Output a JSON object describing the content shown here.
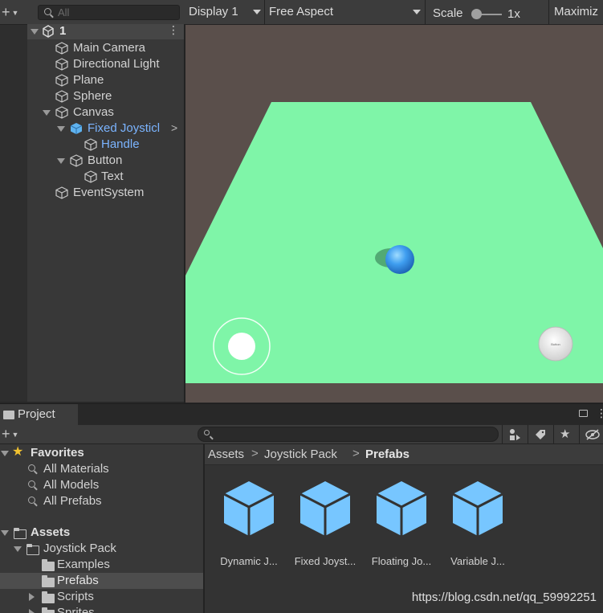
{
  "hierarchy": {
    "search_placeholder": "All",
    "scene_name": "1",
    "items": [
      {
        "label": "Main Camera"
      },
      {
        "label": "Directional Light"
      },
      {
        "label": "Plane"
      },
      {
        "label": "Sphere"
      },
      {
        "label": "Canvas"
      },
      {
        "label": "Fixed Joysticl"
      },
      {
        "label": "Handle"
      },
      {
        "label": "Button"
      },
      {
        "label": "Text"
      },
      {
        "label": "EventSystem"
      }
    ]
  },
  "game_toolbar": {
    "display": "Display 1",
    "aspect": "Free Aspect",
    "scale_label": "Scale",
    "scale_value": "1x",
    "maximize": "Maximiz"
  },
  "game_view": {
    "button_text": "Button"
  },
  "project": {
    "tab_label": "Project",
    "tree": {
      "favorites": "Favorites",
      "fav_items": [
        "All Materials",
        "All Models",
        "All Prefabs"
      ],
      "assets": "Assets",
      "joystick_pack": "Joystick Pack",
      "examples": "Examples",
      "prefabs": "Prefabs",
      "scripts": "Scripts",
      "sprites": "Sprites"
    },
    "breadcrumb": [
      "Assets",
      "Joystick Pack",
      "Prefabs"
    ],
    "assets_grid": [
      "Dynamic J...",
      "Fixed Joyst...",
      "Floating Jo...",
      "Variable J..."
    ]
  },
  "watermark": "https://blog.csdn.net/qq_59992251",
  "colors": {
    "plane": "#7ff5a8",
    "sky": "#5a4f4b",
    "selection_blue": "#7bb4ff",
    "prefab_icon": "#77c6ff"
  }
}
